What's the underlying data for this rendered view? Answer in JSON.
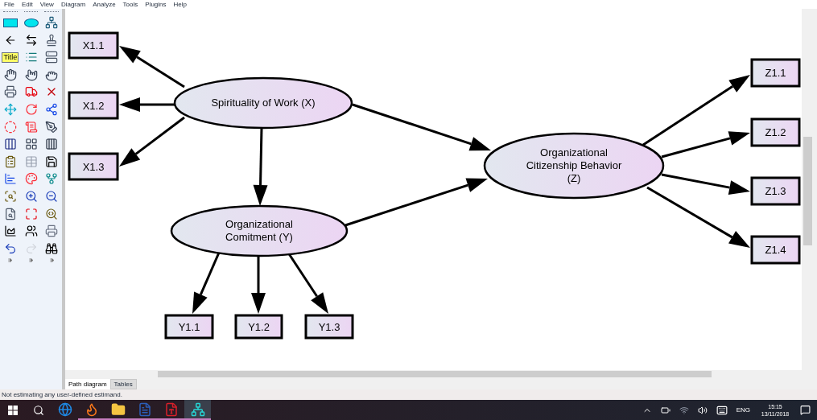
{
  "menu_bar": [
    "File",
    "Edit",
    "View",
    "Diagram",
    "Analyze",
    "Tools",
    "Plugins",
    "Help"
  ],
  "toolbox": {
    "title_tool_label": "Title"
  },
  "diagram": {
    "latent_variables": [
      {
        "label": "Spirituality of Work (X)"
      },
      {
        "label": "Organizational Comitment (Y)"
      },
      {
        "label": "Organizational Citizenship Behavior (Z)"
      }
    ],
    "observed_variables": [
      {
        "label": "X1.1"
      },
      {
        "label": "X1.2"
      },
      {
        "label": "X1.3"
      },
      {
        "label": "Y1.1"
      },
      {
        "label": "Y1.2"
      },
      {
        "label": "Y1.3"
      },
      {
        "label": "Z1.1"
      },
      {
        "label": "Z1.2"
      },
      {
        "label": "Z1.3"
      },
      {
        "label": "Z1.4"
      }
    ]
  },
  "tabs": [
    {
      "label": "Path diagram",
      "selected": true
    },
    {
      "label": "Tables",
      "selected": false
    }
  ],
  "status_bar": "Not estimating any user-defined estimand.",
  "taskbar": {
    "apps": [
      {
        "kind": "edge",
        "running": false,
        "selected": false
      },
      {
        "kind": "firefox",
        "running": true,
        "selected": false
      },
      {
        "kind": "folder",
        "running": true,
        "selected": false
      },
      {
        "kind": "word",
        "running": true,
        "selected": false
      },
      {
        "kind": "acrobat",
        "running": true,
        "selected": false
      },
      {
        "kind": "amos",
        "running": true,
        "selected": true
      }
    ],
    "language": "ENG",
    "time": "15:15",
    "date": "13/11/2018"
  }
}
